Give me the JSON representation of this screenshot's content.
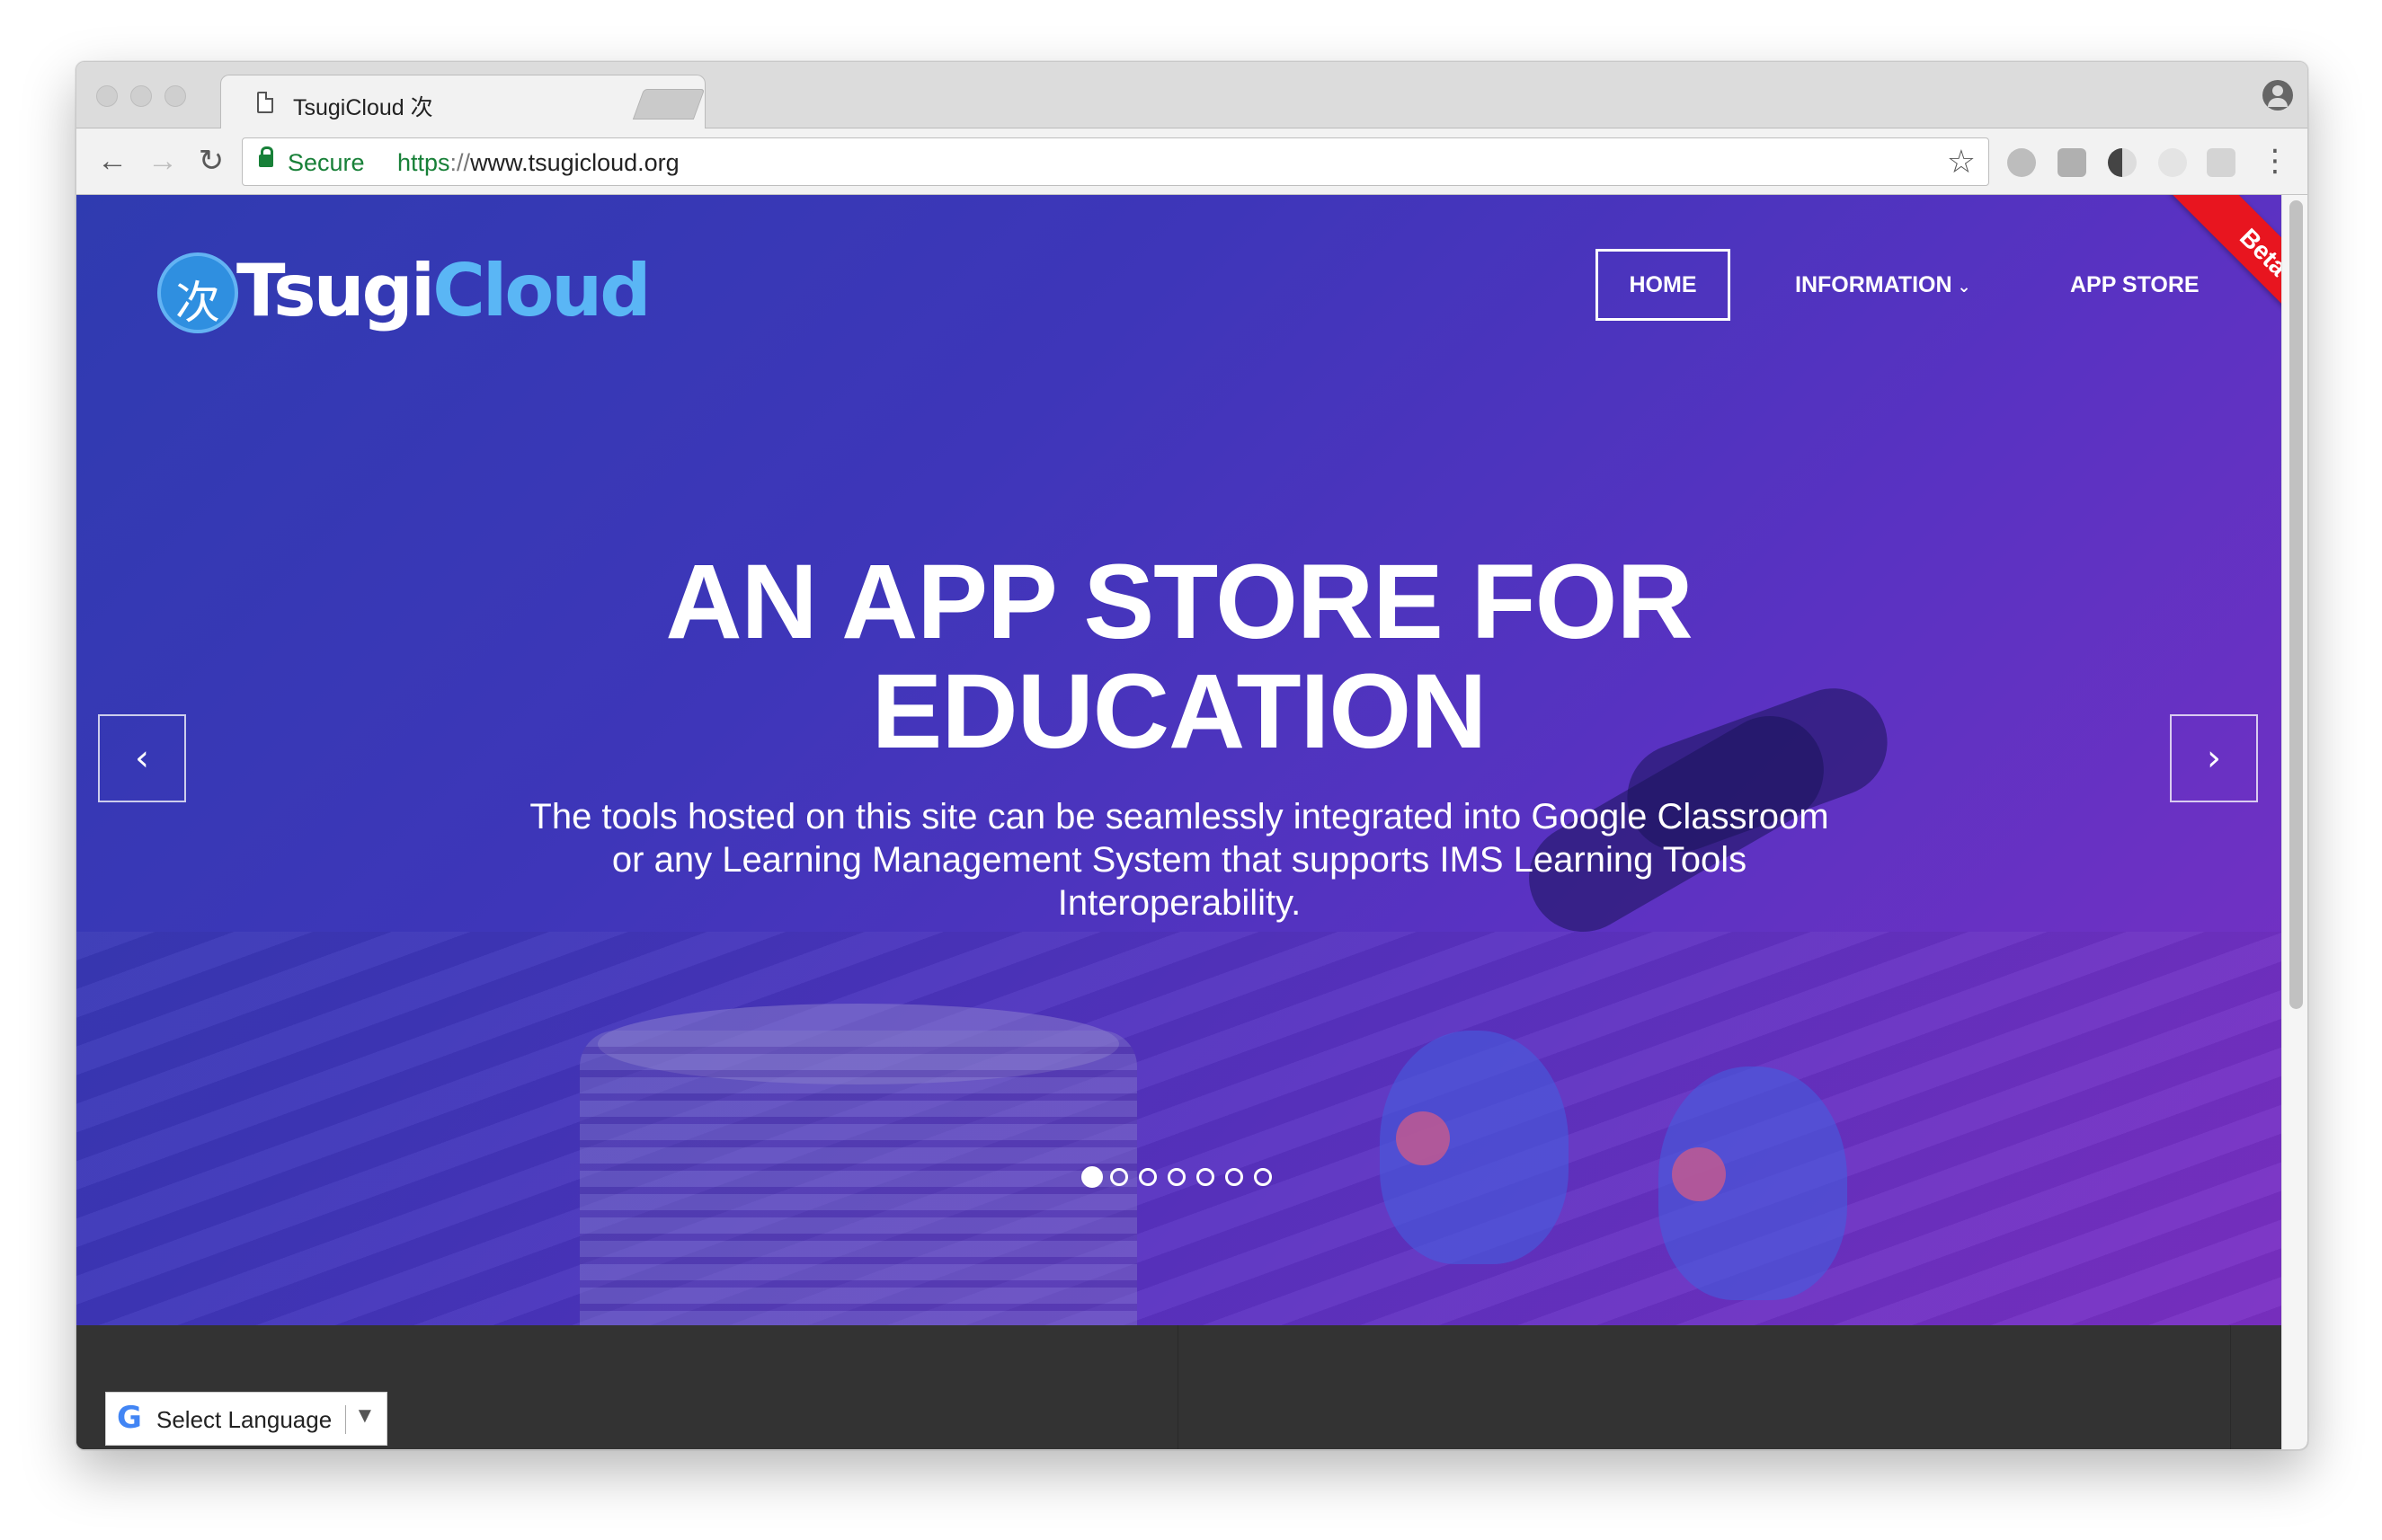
{
  "browser": {
    "tab_title": "TsugiCloud 次",
    "tab_close": "×",
    "secure_label": "Secure",
    "url_scheme": "https",
    "url_sep": "://",
    "url_rest": "www.tsugicloud.org",
    "back_icon": "←",
    "forward_icon": "→",
    "reload_icon": "↻",
    "star_icon": "☆",
    "menu_icon": "⋮"
  },
  "site": {
    "logo_glyph": "次",
    "logo_text_white": "Tsugi",
    "logo_text_blue": "Cloud",
    "nav": {
      "home": "HOME",
      "information": "INFORMATION",
      "information_chevron": "⌄",
      "app_store": "APP STORE"
    },
    "ribbon": "Beta",
    "hero": {
      "title_line1": "AN APP STORE FOR",
      "title_line2": "EDUCATION",
      "subtitle": "The tools hosted on this site can be seamlessly integrated into Google Classroom or any Learning Management System that supports IMS Learning Tools Interoperability."
    },
    "carousel": {
      "prev": "‹",
      "next": "›",
      "slide_count": 7,
      "active_slide": 1
    },
    "translate": {
      "g_letter": "G",
      "label": "Select Language",
      "caret": "▼"
    }
  },
  "colors": {
    "accent_blue": "#5ab6f5",
    "secure_green": "#188038",
    "ribbon_red": "#e8151f",
    "footer_dark": "#333333"
  }
}
